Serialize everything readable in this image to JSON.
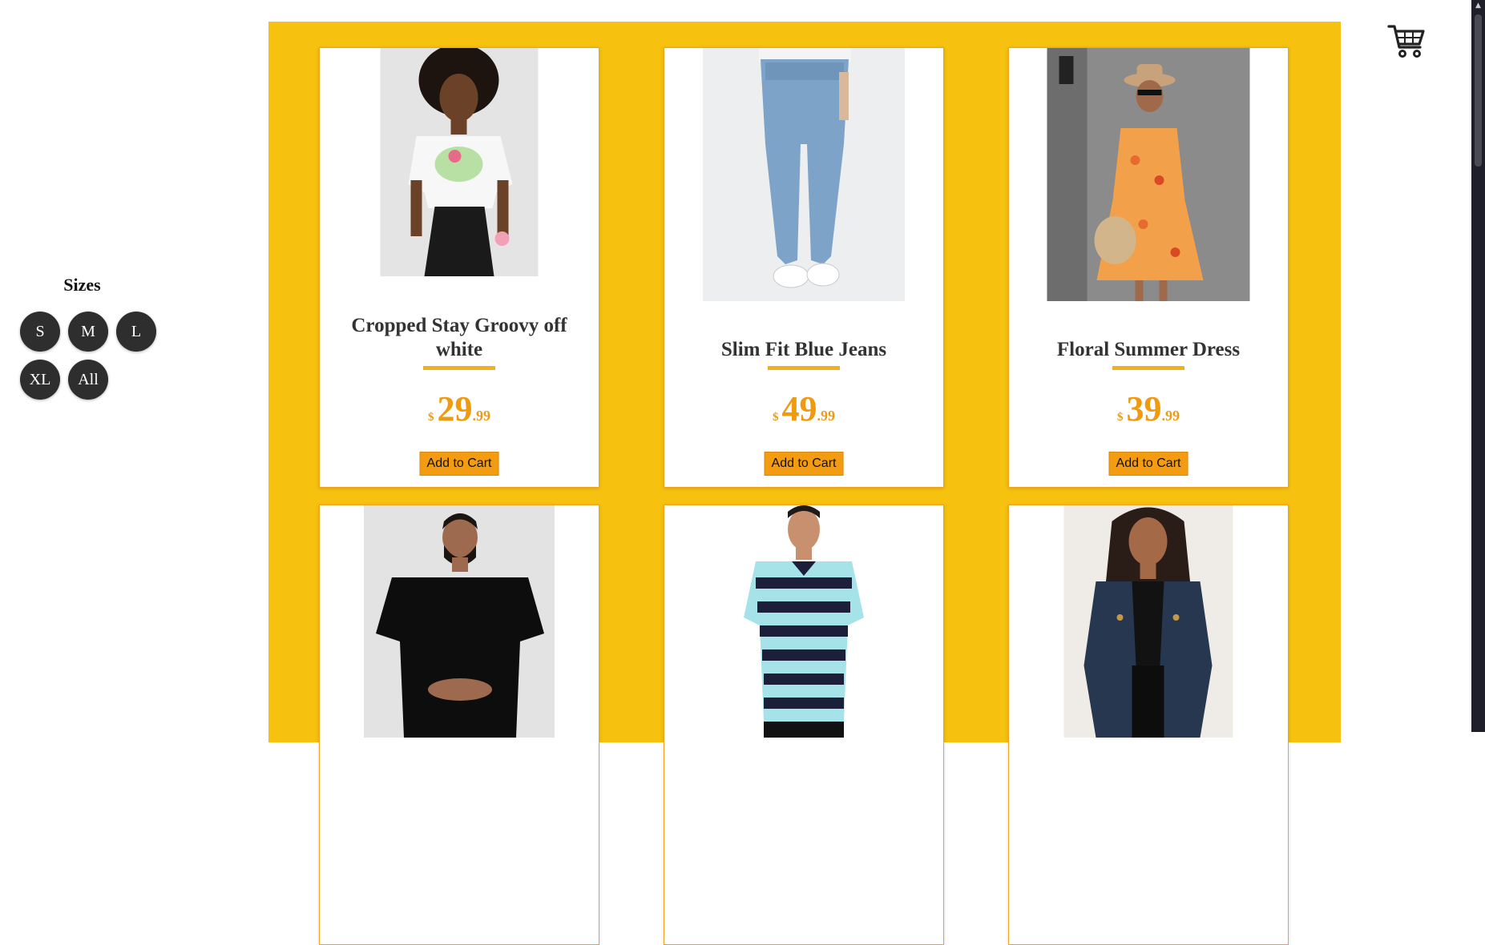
{
  "filter": {
    "title": "Sizes",
    "sizes": [
      "S",
      "M",
      "L",
      "XL",
      "All"
    ]
  },
  "products": [
    {
      "name": "Cropped Stay Groovy off white",
      "price_currency": "$",
      "price_whole": "29",
      "price_cents": ".99",
      "button": "Add to Cart"
    },
    {
      "name": "Slim Fit Blue Jeans",
      "price_currency": "$",
      "price_whole": "49",
      "price_cents": ".99",
      "button": "Add to Cart"
    },
    {
      "name": "Floral Summer Dress",
      "price_currency": "$",
      "price_whole": "39",
      "price_cents": ".99",
      "button": "Add to Cart"
    },
    {
      "name": "",
      "button": ""
    },
    {
      "name": "",
      "button": ""
    },
    {
      "name": "",
      "button": ""
    }
  ],
  "icons": {
    "cart": "cart-icon"
  },
  "colors": {
    "panel": "#f6c10f",
    "accent": "#ef9a0f",
    "button": "#f39c12",
    "size_button": "#2e2e2e"
  }
}
